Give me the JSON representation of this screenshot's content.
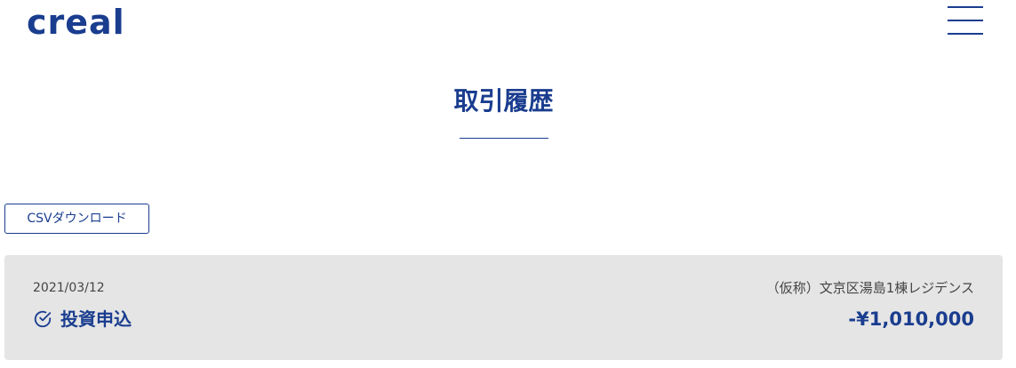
{
  "header": {
    "logo_text": "creal",
    "menu_icon": "hamburger-menu-icon"
  },
  "page": {
    "title": "取引履歴"
  },
  "toolbar": {
    "csv_label": "CSVダウンロード"
  },
  "transactions": [
    {
      "date": "2021/03/12",
      "type_icon": "check-circle-icon",
      "type": "投資申込",
      "property": "（仮称）文京区湯島1棟レジデンス",
      "amount": "-¥1,010,000"
    }
  ],
  "colors": {
    "brand": "#1a3d8f",
    "card_bg": "#e5e5e5",
    "text": "#444444"
  }
}
